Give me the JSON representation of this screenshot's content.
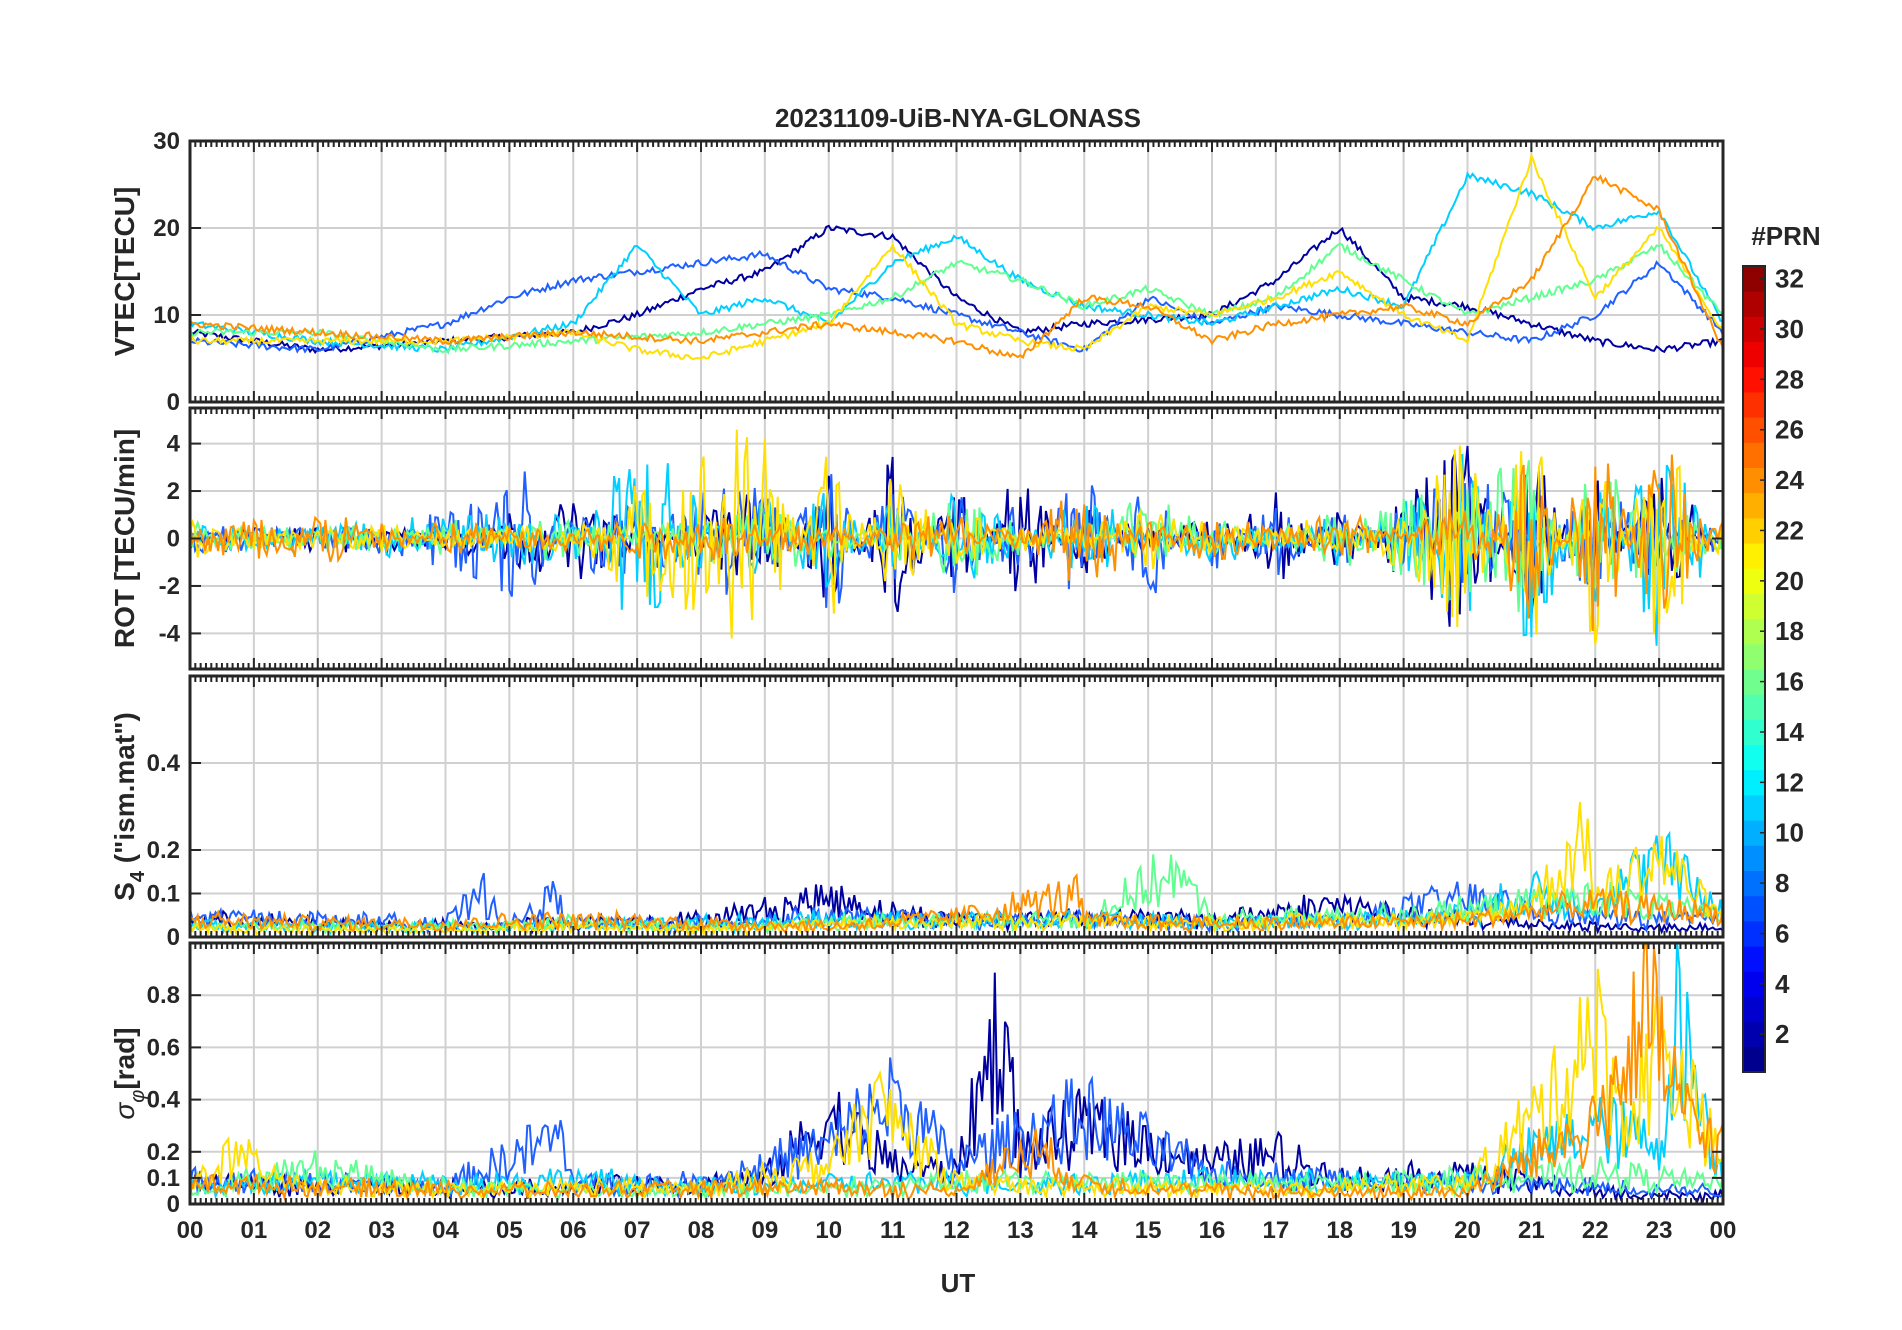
{
  "title": "20231109-UiB-NYA-GLONASS",
  "xlabel": "UT",
  "x_ticks": [
    "00",
    "01",
    "02",
    "03",
    "04",
    "05",
    "06",
    "07",
    "08",
    "09",
    "10",
    "11",
    "12",
    "13",
    "14",
    "15",
    "16",
    "17",
    "18",
    "19",
    "20",
    "21",
    "22",
    "23",
    "00"
  ],
  "colorbar": {
    "label": "#PRN",
    "range": [
      1,
      32
    ],
    "ticks": [
      "2",
      "4",
      "6",
      "8",
      "10",
      "12",
      "14",
      "16",
      "18",
      "20",
      "22",
      "24",
      "26",
      "28",
      "30",
      "32"
    ],
    "colormap": "jet"
  },
  "panels": [
    {
      "id": "vtec",
      "ylabel": "VTEC[TECU]",
      "ylim": [
        0,
        30
      ],
      "yticks": [
        "0",
        "10",
        "20",
        "30"
      ],
      "ytick_values": [
        0,
        10,
        20,
        30
      ]
    },
    {
      "id": "rot",
      "ylabel": "ROT [TECU/min]",
      "ylim": [
        -5.5,
        5.5
      ],
      "yticks": [
        "-4",
        "-2",
        "0",
        "2",
        "4"
      ],
      "ytick_values": [
        -4,
        -2,
        0,
        2,
        4
      ]
    },
    {
      "id": "s4",
      "ylabel_main": "S",
      "ylabel_sub": "4",
      "ylabel_rest": " (\"ism.mat\")",
      "ylim": [
        0,
        0.6
      ],
      "yticks": [
        "0",
        "0.1",
        "0.2",
        "0.4"
      ],
      "ytick_values": [
        0,
        0.1,
        0.2,
        0.4
      ]
    },
    {
      "id": "sigma",
      "ylabel_main": "σ",
      "ylabel_sub": "φ",
      "ylabel_rest": "[rad]",
      "ylim": [
        0,
        1
      ],
      "yticks": [
        "0",
        "0.1",
        "0.2",
        "0.4",
        "0.6",
        "0.8"
      ],
      "ytick_values": [
        0,
        0.1,
        0.2,
        0.4,
        0.6,
        0.8
      ]
    }
  ],
  "chart_data": [
    {
      "type": "line",
      "panel": "vtec",
      "ylabel": "VTEC[TECU]",
      "xlabel": "",
      "xlim": [
        0,
        24
      ],
      "ylim": [
        0,
        30
      ],
      "series": [
        {
          "color": "#0000a0",
          "x": [
            0,
            2,
            4,
            6,
            7,
            8,
            9,
            10,
            11,
            12,
            13,
            14,
            16,
            17,
            18,
            19,
            20,
            21,
            22,
            23,
            24
          ],
          "values": [
            8,
            6,
            7,
            8,
            10,
            13,
            15,
            20,
            19,
            12,
            8,
            9,
            10,
            14,
            20,
            12,
            11,
            9,
            7,
            6,
            7
          ]
        },
        {
          "color": "#2060ff",
          "x": [
            0,
            2,
            4,
            5,
            6,
            8,
            9,
            10,
            11,
            12,
            13,
            14,
            15,
            16,
            17,
            18,
            19,
            20,
            21,
            22,
            23,
            24
          ],
          "values": [
            7,
            6,
            9,
            12,
            14,
            16,
            17,
            13,
            12,
            10,
            8,
            6,
            12,
            9,
            11,
            10,
            9,
            8,
            7,
            10,
            16,
            8
          ]
        },
        {
          "color": "#00d0ff",
          "x": [
            0,
            2,
            4,
            6,
            7,
            8,
            9,
            10,
            11,
            12,
            13,
            14,
            16,
            18,
            19,
            20,
            21,
            22,
            23,
            24
          ],
          "values": [
            9,
            7,
            6,
            9,
            18,
            10,
            12,
            9,
            16,
            19,
            14,
            11,
            9,
            13,
            11,
            26,
            24,
            20,
            22,
            9
          ]
        },
        {
          "color": "#60ff90",
          "x": [
            0,
            2,
            4,
            6,
            8,
            9,
            10,
            11,
            12,
            13,
            14,
            15,
            16,
            17,
            18,
            19,
            20,
            21,
            22,
            23,
            24
          ],
          "values": [
            8,
            8,
            6,
            7,
            8,
            9,
            10,
            12,
            16,
            14,
            11,
            13,
            10,
            12,
            18,
            14,
            10,
            12,
            14,
            18,
            10
          ]
        },
        {
          "color": "#ffe000",
          "x": [
            0,
            2,
            4,
            6,
            7,
            8,
            9,
            10,
            11,
            12,
            13,
            14,
            15,
            16,
            17,
            18,
            19,
            20,
            21,
            22,
            23,
            24
          ],
          "values": [
            7,
            7,
            7,
            8,
            6,
            5,
            7,
            9,
            18,
            9,
            7,
            6,
            11,
            10,
            12,
            15,
            10,
            7,
            28,
            12,
            20,
            8
          ]
        },
        {
          "color": "#ff9000",
          "x": [
            0,
            2,
            4,
            6,
            8,
            10,
            12,
            13,
            14,
            15,
            16,
            17,
            18,
            19,
            20,
            21,
            22,
            23,
            24
          ],
          "values": [
            9,
            8,
            7,
            8,
            7,
            9,
            7,
            5,
            12,
            11,
            7,
            9,
            10,
            11,
            9,
            14,
            26,
            22,
            6
          ]
        }
      ]
    },
    {
      "type": "line",
      "panel": "rot",
      "ylabel": "ROT [TECU/min]",
      "xlabel": "",
      "xlim": [
        0,
        24
      ],
      "ylim": [
        -5.5,
        5.5
      ],
      "series": [
        {
          "color": "#0000a0",
          "x": [
            0,
            3,
            6,
            9,
            10,
            11,
            12,
            13,
            14,
            16,
            17,
            18,
            20,
            21,
            22,
            23,
            24
          ],
          "values": [
            0.2,
            -0.3,
            1.5,
            -2,
            3,
            -4,
            2.5,
            -3,
            1.5,
            -1,
            2,
            -1.5,
            5,
            -4,
            3,
            -3,
            0.5
          ]
        },
        {
          "color": "#2060ff",
          "x": [
            0,
            3,
            4.5,
            5,
            6,
            9,
            10,
            11,
            12,
            13,
            14,
            15,
            16,
            17,
            18,
            20,
            22,
            24
          ],
          "values": [
            -0.5,
            0.4,
            2,
            -4,
            1,
            2.5,
            -3.5,
            3,
            -2.5,
            2,
            -3,
            2.5,
            -1.5,
            1.5,
            -1,
            3,
            -2,
            0
          ]
        },
        {
          "color": "#00d0ff",
          "x": [
            0,
            3,
            6,
            7,
            9,
            10,
            11,
            12,
            14,
            16,
            18,
            20,
            21,
            22,
            23,
            24
          ],
          "values": [
            0.3,
            -0.4,
            -1,
            5,
            -2,
            3,
            -2,
            2,
            -1.5,
            1,
            -1,
            4,
            -5,
            3,
            -5,
            0.2
          ]
        },
        {
          "color": "#60ff90",
          "x": [
            0,
            2,
            4,
            6,
            9,
            12,
            15,
            18,
            21,
            22,
            24
          ],
          "values": [
            -0.4,
            0.6,
            -0.5,
            0.8,
            -1.5,
            1.5,
            -1.5,
            1,
            3,
            -3,
            0
          ]
        },
        {
          "color": "#ffe000",
          "x": [
            0,
            3,
            6,
            8.8,
            9,
            10,
            11,
            12,
            15,
            18,
            20,
            21,
            22,
            23,
            24
          ],
          "values": [
            0.5,
            -0.3,
            0.4,
            5,
            -5,
            4,
            -3,
            1,
            -1,
            0.8,
            -4,
            5,
            -5,
            5,
            -1
          ]
        },
        {
          "color": "#ff9000",
          "x": [
            0,
            2,
            4,
            6,
            9,
            12,
            14,
            16,
            18,
            20,
            21,
            22,
            23,
            24
          ],
          "values": [
            0.3,
            1.2,
            -0.6,
            0.5,
            0.8,
            -1,
            1.8,
            -1,
            1,
            -1.5,
            4,
            -5,
            4,
            -0.5
          ]
        }
      ]
    },
    {
      "type": "line",
      "panel": "s4",
      "ylabel": "S4 (\"ism.mat\")",
      "xlabel": "",
      "xlim": [
        0,
        24
      ],
      "ylim": [
        0,
        0.6
      ],
      "series": [
        {
          "color": "#0000a0",
          "x": [
            0,
            2,
            4,
            6,
            8,
            9,
            10,
            11,
            12,
            14,
            16,
            18,
            19,
            20,
            21,
            22,
            24
          ],
          "values": [
            0.05,
            0.04,
            0.03,
            0.04,
            0.05,
            0.08,
            0.12,
            0.07,
            0.05,
            0.06,
            0.05,
            0.1,
            0.06,
            0.05,
            0.04,
            0.03,
            0.02
          ]
        },
        {
          "color": "#2060ff",
          "x": [
            0,
            2,
            4,
            4.6,
            5,
            5.7,
            6,
            8,
            10,
            12,
            14,
            16,
            18,
            20,
            21,
            22,
            24
          ],
          "values": [
            0.06,
            0.05,
            0.04,
            0.13,
            0.03,
            0.12,
            0.04,
            0.04,
            0.06,
            0.05,
            0.05,
            0.04,
            0.05,
            0.12,
            0.08,
            0.06,
            0.05
          ]
        },
        {
          "color": "#00d0ff",
          "x": [
            0,
            2,
            4,
            6,
            8,
            10,
            12,
            14,
            16,
            18,
            20,
            21,
            22,
            23,
            24
          ],
          "values": [
            0.04,
            0.03,
            0.03,
            0.03,
            0.04,
            0.05,
            0.05,
            0.05,
            0.04,
            0.05,
            0.07,
            0.14,
            0.1,
            0.24,
            0.08
          ]
        },
        {
          "color": "#60ff90",
          "x": [
            0,
            2,
            4,
            6,
            8,
            10,
            12,
            14,
            15.4,
            16,
            18,
            20,
            22,
            24
          ],
          "values": [
            0.03,
            0.03,
            0.03,
            0.04,
            0.03,
            0.04,
            0.05,
            0.05,
            0.2,
            0.05,
            0.06,
            0.08,
            0.12,
            0.06
          ]
        },
        {
          "color": "#ffe000",
          "x": [
            0,
            2,
            4,
            6,
            8,
            10,
            12,
            14,
            16,
            18,
            20,
            21,
            21.9,
            22,
            23,
            24
          ],
          "values": [
            0.03,
            0.02,
            0.02,
            0.03,
            0.02,
            0.04,
            0.04,
            0.05,
            0.04,
            0.05,
            0.05,
            0.1,
            0.32,
            0.12,
            0.25,
            0.05
          ]
        },
        {
          "color": "#ff9000",
          "x": [
            0,
            2,
            4,
            6,
            8,
            10,
            12,
            13.9,
            14,
            16,
            18,
            20,
            22,
            24
          ],
          "values": [
            0.05,
            0.04,
            0.04,
            0.05,
            0.04,
            0.03,
            0.06,
            0.13,
            0.05,
            0.04,
            0.04,
            0.05,
            0.1,
            0.07
          ]
        }
      ]
    },
    {
      "type": "line",
      "panel": "sigma",
      "ylabel": "σφ [rad]",
      "xlabel": "UT",
      "xlim": [
        0,
        24
      ],
      "ylim": [
        0,
        1
      ],
      "series": [
        {
          "color": "#0000a0",
          "x": [
            0,
            2,
            4,
            6,
            8,
            9,
            10,
            11,
            12,
            12.7,
            13,
            14,
            16,
            17,
            18,
            20,
            22,
            24
          ],
          "values": [
            0.1,
            0.08,
            0.07,
            0.08,
            0.1,
            0.12,
            0.45,
            0.2,
            0.15,
            0.98,
            0.25,
            0.4,
            0.2,
            0.25,
            0.12,
            0.15,
            0.05,
            0.03
          ]
        },
        {
          "color": "#2060ff",
          "x": [
            0,
            2,
            4,
            5.8,
            6,
            8,
            10,
            11,
            12,
            13,
            14,
            15,
            16,
            18,
            20,
            22,
            24
          ],
          "values": [
            0.12,
            0.1,
            0.08,
            0.35,
            0.1,
            0.1,
            0.3,
            0.55,
            0.2,
            0.35,
            0.45,
            0.3,
            0.15,
            0.12,
            0.1,
            0.08,
            0.06
          ]
        },
        {
          "color": "#00d0ff",
          "x": [
            0,
            2,
            4,
            6,
            8,
            10,
            12,
            14,
            16,
            18,
            20,
            22,
            23,
            23.3,
            24
          ],
          "values": [
            0.08,
            0.12,
            0.1,
            0.12,
            0.08,
            0.1,
            0.1,
            0.1,
            0.12,
            0.1,
            0.12,
            0.4,
            0.3,
            0.98,
            0.1
          ]
        },
        {
          "color": "#60ff90",
          "x": [
            0,
            2,
            4,
            6,
            8,
            10,
            12,
            14,
            16,
            18,
            20,
            22,
            24
          ],
          "values": [
            0.06,
            0.18,
            0.08,
            0.07,
            0.06,
            0.08,
            0.1,
            0.12,
            0.1,
            0.1,
            0.12,
            0.15,
            0.1
          ]
        },
        {
          "color": "#ffe000",
          "x": [
            0,
            0.6,
            2,
            4,
            6,
            8,
            10,
            10.8,
            12,
            14,
            16,
            18,
            20,
            21.5,
            21.9,
            22.5,
            23,
            24
          ],
          "values": [
            0.08,
            0.25,
            0.08,
            0.06,
            0.08,
            0.07,
            0.2,
            0.5,
            0.1,
            0.08,
            0.07,
            0.08,
            0.1,
            0.6,
            0.98,
            0.4,
            0.85,
            0.2
          ]
        },
        {
          "color": "#ff9000",
          "x": [
            0,
            2,
            4,
            6,
            8,
            10,
            12,
            13.2,
            14,
            16,
            18,
            20,
            22,
            22.8,
            23.5,
            24
          ],
          "values": [
            0.1,
            0.08,
            0.07,
            0.06,
            0.07,
            0.08,
            0.06,
            0.28,
            0.1,
            0.06,
            0.05,
            0.06,
            0.4,
            0.98,
            0.4,
            0.3
          ]
        }
      ]
    }
  ]
}
